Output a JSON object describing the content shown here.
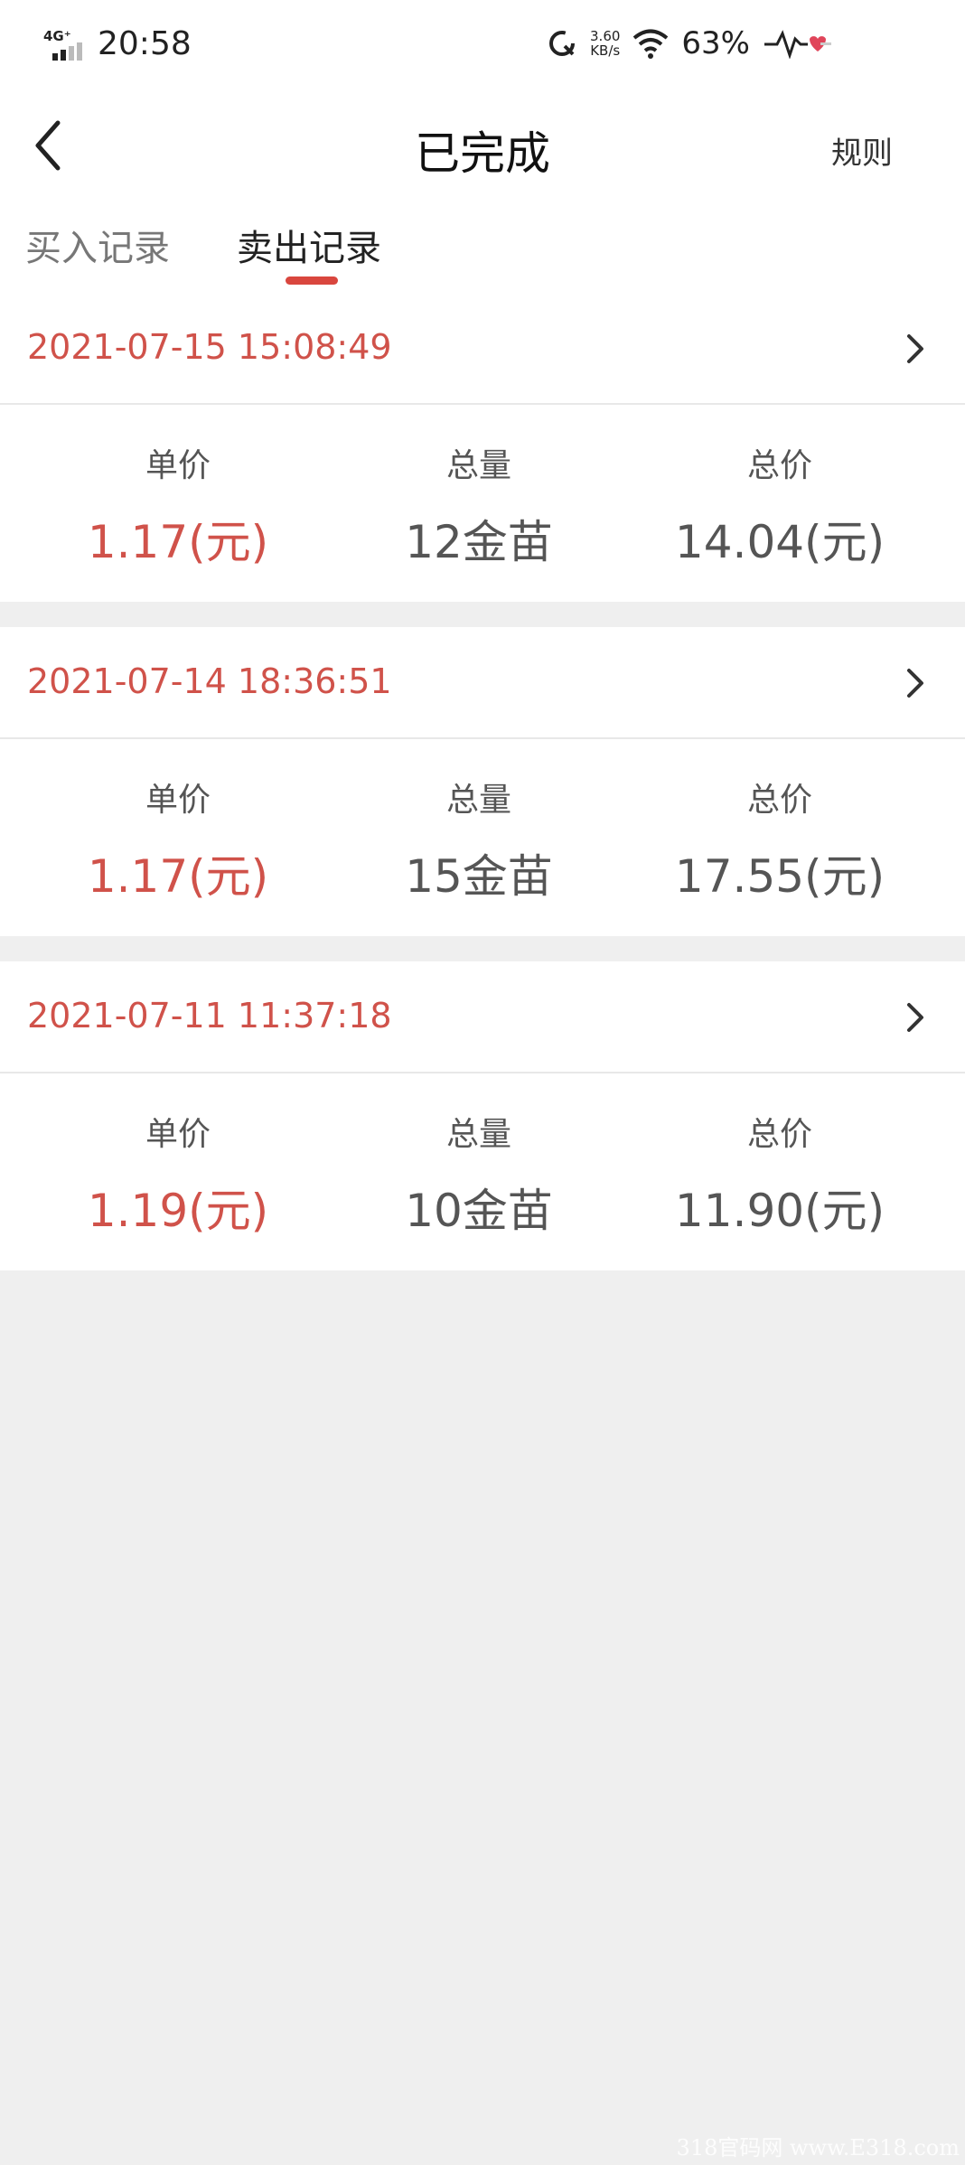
{
  "status_bar": {
    "network": "4G⁺",
    "time": "20:58",
    "speed_value": "3.60",
    "speed_unit": "KB/s",
    "battery": "63%"
  },
  "nav": {
    "title": "已完成",
    "rules_label": "规则"
  },
  "tabs": [
    {
      "label": "买入记录",
      "active": false
    },
    {
      "label": "卖出记录",
      "active": true
    }
  ],
  "records": [
    {
      "datetime": "2021-07-15 15:08:49",
      "unit_price_label": "单价",
      "unit_price": "1.17(元)",
      "quantity_label": "总量",
      "quantity": "12金苗",
      "total_label": "总价",
      "total": "14.04(元)"
    },
    {
      "datetime": "2021-07-14 18:36:51",
      "unit_price_label": "单价",
      "unit_price": "1.17(元)",
      "quantity_label": "总量",
      "quantity": "15金苗",
      "total_label": "总价",
      "total": "17.55(元)"
    },
    {
      "datetime": "2021-07-11 11:37:18",
      "unit_price_label": "单价",
      "unit_price": "1.19(元)",
      "quantity_label": "总量",
      "quantity": "10金苗",
      "total_label": "总价",
      "total": "11.90(元)"
    }
  ],
  "watermark": "318官码网 www.E318.com",
  "colors": {
    "accent": "#d0524a",
    "indicator": "#d9463e",
    "background": "#efefef"
  }
}
